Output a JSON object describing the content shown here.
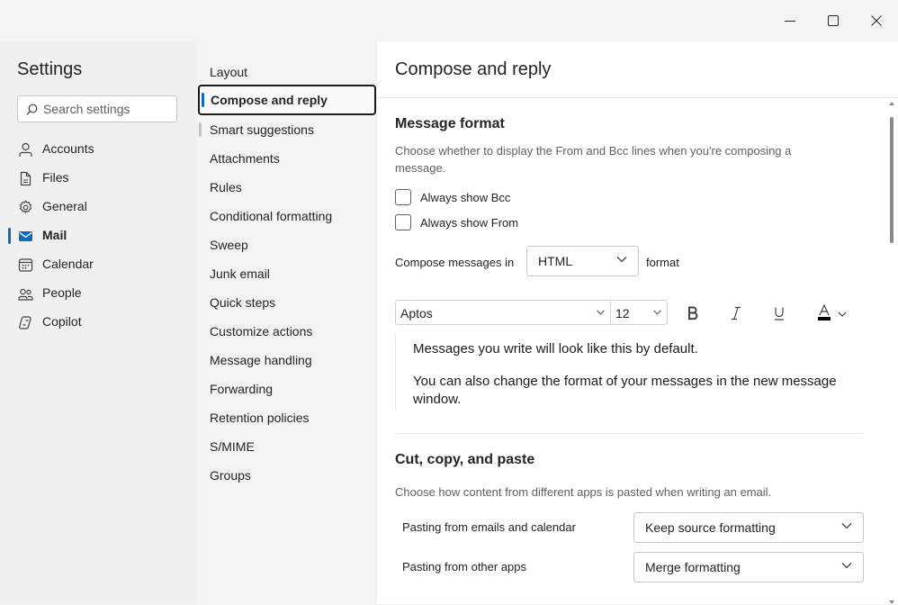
{
  "window": {
    "minimize_icon": "minimize-icon",
    "maximize_icon": "maximize-icon",
    "close_icon": "close-icon"
  },
  "settings": {
    "title": "Settings",
    "search": {
      "placeholder": "Search settings",
      "value": ""
    },
    "nav": [
      {
        "label": "Accounts",
        "icon": "person-icon"
      },
      {
        "label": "Files",
        "icon": "document-icon"
      },
      {
        "label": "General",
        "icon": "gear-icon"
      },
      {
        "label": "Mail",
        "icon": "mail-icon",
        "active": true
      },
      {
        "label": "Calendar",
        "icon": "calendar-icon"
      },
      {
        "label": "People",
        "icon": "people-icon"
      },
      {
        "label": "Copilot",
        "icon": "copilot-icon"
      }
    ]
  },
  "mail_sub": [
    {
      "label": "Layout"
    },
    {
      "label": "Compose and reply",
      "selected": true
    },
    {
      "label": "Smart suggestions"
    },
    {
      "label": "Attachments"
    },
    {
      "label": "Rules"
    },
    {
      "label": "Conditional formatting"
    },
    {
      "label": "Sweep"
    },
    {
      "label": "Junk email"
    },
    {
      "label": "Quick steps"
    },
    {
      "label": "Customize actions"
    },
    {
      "label": "Message handling"
    },
    {
      "label": "Forwarding"
    },
    {
      "label": "Retention policies"
    },
    {
      "label": "S/MIME"
    },
    {
      "label": "Groups"
    }
  ],
  "compose": {
    "page_title": "Compose and reply",
    "message_format": {
      "heading": "Message format",
      "description": "Choose whether to display the From and Bcc lines when you're composing a message.",
      "always_show_bcc": {
        "label": "Always show Bcc",
        "checked": false
      },
      "always_show_from": {
        "label": "Always show From",
        "checked": false
      },
      "compose_prefix": "Compose messages in",
      "compose_format": "HTML",
      "compose_suffix": "format"
    },
    "font": {
      "family": "Aptos",
      "size": "12",
      "bold_icon": "bold-icon",
      "italic_icon": "italic-icon",
      "underline_icon": "underline-icon",
      "font_color_icon": "font-color-icon",
      "font_color": "#000000"
    },
    "preview": {
      "line1": "Messages you write will look like this by default.",
      "line2": "You can also change the format of your messages in the new message window."
    },
    "paste": {
      "heading": "Cut, copy, and paste",
      "description": "Choose how content from different apps is pasted when writing an email.",
      "emails_label": "Pasting from emails and calendar",
      "emails_value": "Keep source formatting",
      "other_label": "Pasting from other apps",
      "other_value": "Merge formatting"
    }
  },
  "colors": {
    "accent": "#0f6cbd",
    "background": "#f3f3f3",
    "pane": "#ffffff"
  }
}
